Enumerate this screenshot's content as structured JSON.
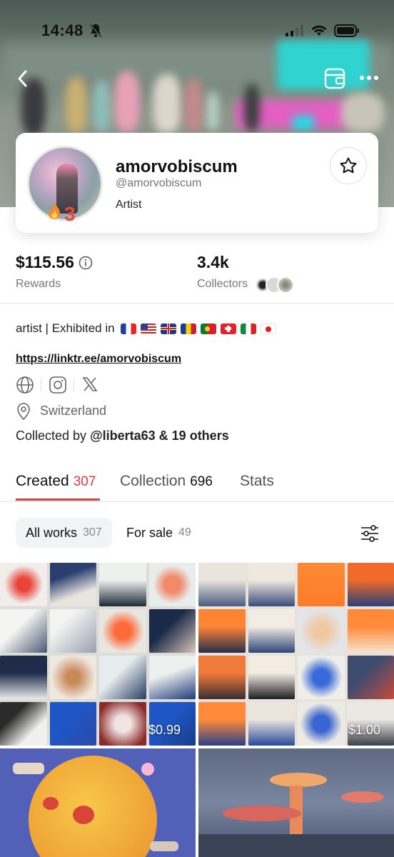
{
  "status_bar": {
    "time": "14:48"
  },
  "profile": {
    "username": "amorvobiscum",
    "handle": "@amorvobiscum",
    "role": "Artist",
    "streak": "3"
  },
  "stats": {
    "rewards_value": "$115.56",
    "rewards_label": "Rewards",
    "collectors_value": "3.4k",
    "collectors_label": "Collectors"
  },
  "bio": {
    "text": "artist | Exhibited in",
    "flags": [
      "France",
      "United States",
      "United Kingdom",
      "Romania",
      "Portugal",
      "Switzerland",
      "Italy",
      "Japan"
    ],
    "link": "https://linktr.ee/amorvobiscum",
    "location": "Switzerland",
    "collected_prefix": "Collected by",
    "collected_by": "@liberta63 & 19 others"
  },
  "tabs": [
    {
      "label": "Created",
      "count": "307"
    },
    {
      "label": "Collection",
      "count": "696"
    },
    {
      "label": "Stats",
      "count": ""
    }
  ],
  "filters": [
    {
      "label": "All works",
      "count": "307"
    },
    {
      "label": "For sale",
      "count": "49"
    }
  ],
  "grid": [
    {
      "price": "$0.99"
    },
    {
      "price": "$1.00"
    }
  ],
  "colors": {
    "accent": "#e23b3b",
    "streak": "#ea4a3c"
  }
}
